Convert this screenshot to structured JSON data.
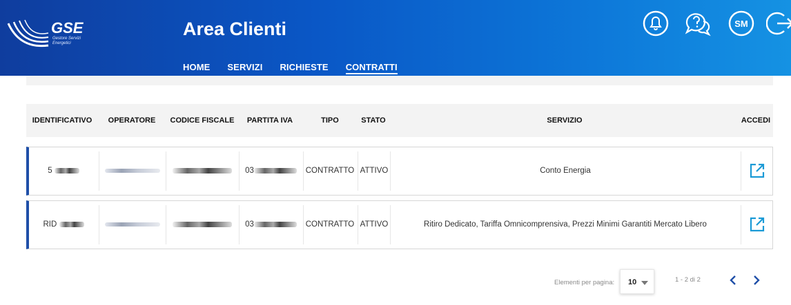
{
  "header": {
    "logo": {
      "text": "GSE",
      "subtitle": "Gestore Servizi Energetici"
    },
    "title": "Area Clienti",
    "nav": [
      {
        "label": "HOME",
        "active": false
      },
      {
        "label": "SERVIZI",
        "active": false
      },
      {
        "label": "RICHIESTE",
        "active": false
      },
      {
        "label": "CONTRATTI",
        "active": true
      }
    ],
    "icons": [
      {
        "name": "notifications-bell-icon"
      },
      {
        "name": "help-chat-icon"
      },
      {
        "name": "user-avatar-icon",
        "initials": "SM"
      },
      {
        "name": "logout-icon"
      }
    ]
  },
  "table": {
    "columns": [
      "IDENTIFICATIVO",
      "OPERATORE",
      "CODICE FISCALE",
      "PARTITA IVA",
      "TIPO",
      "STATO",
      "SERVIZIO",
      "ACCEDI"
    ],
    "rows": [
      {
        "identificativo_prefix": "5",
        "partita_iva_prefix": "03",
        "tipo": "CONTRATTO",
        "stato": "ATTIVO",
        "servizio": "Conto Energia"
      },
      {
        "identificativo_prefix": "RID",
        "partita_iva_prefix": "03",
        "tipo": "CONTRATTO",
        "stato": "ATTIVO",
        "servizio": "Ritiro Dedicato, Tariffa Omnicomprensiva, Prezzi Minimi Garantiti Mercato Libero"
      }
    ]
  },
  "pagination": {
    "label": "Elementi per pagina:",
    "page_size": "10",
    "range": "1 - 2 di 2"
  },
  "colors": {
    "accent": "#1f4fa8",
    "link_icon": "#1a9ad6",
    "header_start": "#0f3d9e",
    "header_end": "#1592e3"
  }
}
